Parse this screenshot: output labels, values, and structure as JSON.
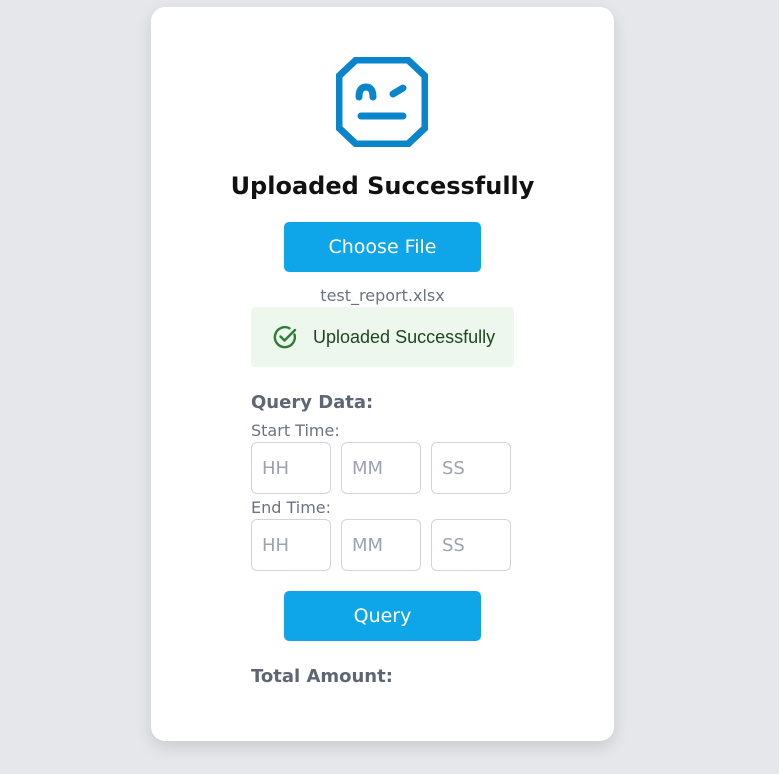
{
  "header": {
    "logo_icon": "robot-face-icon",
    "title": "Uploaded Successfully"
  },
  "upload": {
    "choose_file_label": "Choose File",
    "file_name": "test_report.xlsx",
    "alert": {
      "icon": "check-circle-icon",
      "message": "Uploaded Successfully",
      "color": "#2e7d32",
      "background": "#edf7ed"
    }
  },
  "query": {
    "heading": "Query Data:",
    "start_time": {
      "label": "Start Time:",
      "hours_placeholder": "HH",
      "minutes_placeholder": "MM",
      "seconds_placeholder": "SS"
    },
    "end_time": {
      "label": "End Time:",
      "hours_placeholder": "HH",
      "minutes_placeholder": "MM",
      "seconds_placeholder": "SS"
    },
    "query_button_label": "Query"
  },
  "result": {
    "total_amount_label": "Total Amount:"
  },
  "colors": {
    "accent": "#0ea5e9",
    "logo": "#0a85cc",
    "page_background": "#e5e7eb"
  }
}
